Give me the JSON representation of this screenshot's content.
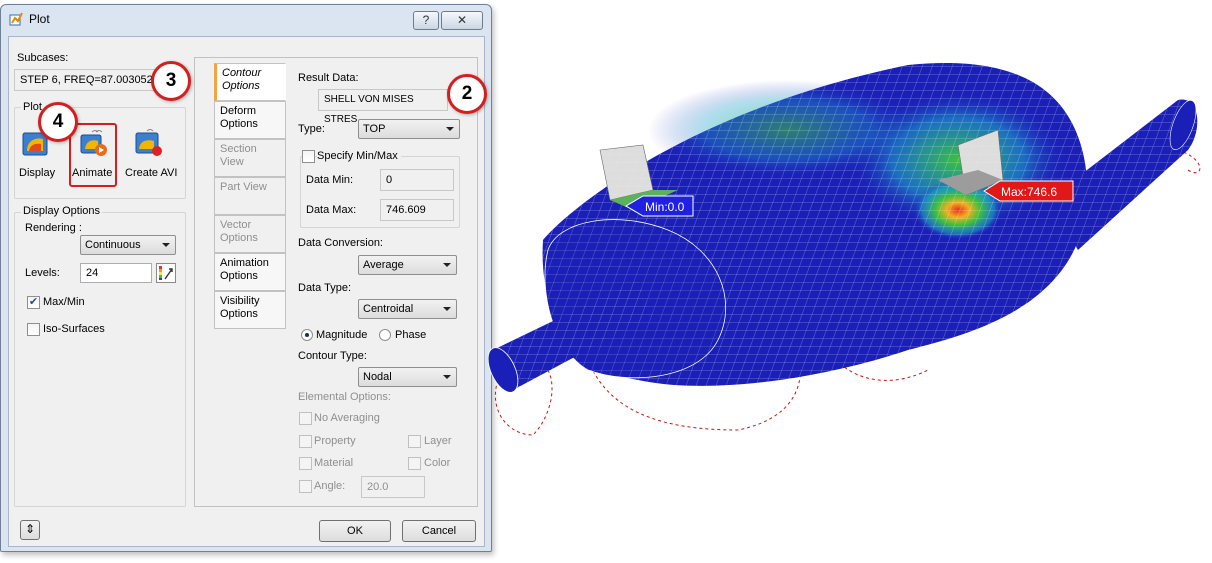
{
  "window": {
    "title": "Plot",
    "help_label": "?",
    "close_label": "✕"
  },
  "subcases": {
    "label": "Subcases:",
    "value": "STEP 6, FREQ=87.003052"
  },
  "plot_group": {
    "label": "Plot",
    "display_label": "Display",
    "animate_label": "Animate",
    "create_avi_label": "Create AVI"
  },
  "display_options": {
    "label": "Display Options",
    "rendering_label": "Rendering :",
    "rendering_value": "Continuous",
    "levels_label": "Levels:",
    "levels_value": "24",
    "maxmin_label": "Max/Min",
    "maxmin_checked": true,
    "iso_label": "Iso-Surfaces",
    "iso_checked": false
  },
  "tabs": [
    {
      "label": "Contour Options",
      "checked": true,
      "active": true,
      "enabled": true
    },
    {
      "label": "Deform Options",
      "checked": true,
      "active": false,
      "enabled": true
    },
    {
      "label": "Section View",
      "checked": false,
      "active": false,
      "enabled": false
    },
    {
      "label": "Part View",
      "checked": false,
      "active": false,
      "enabled": false
    },
    {
      "label": "Vector Options",
      "checked": false,
      "active": false,
      "enabled": false
    },
    {
      "label": "Animation Options",
      "active": false,
      "enabled": true
    },
    {
      "label": "Visibility Options",
      "active": false,
      "enabled": true
    }
  ],
  "contour": {
    "result_data_label": "Result Data:",
    "result_data_value": "SHELL VON MISES STRES",
    "type_label": "Type:",
    "type_value": "TOP",
    "specify_minmax_label": "Specify Min/Max",
    "data_min_label": "Data Min:",
    "data_min_value": "0",
    "data_max_label": "Data Max:",
    "data_max_value": "746.609",
    "data_conversion_label": "Data Conversion:",
    "data_conversion_value": "Average",
    "data_type_label": "Data Type:",
    "data_type_value": "Centroidal",
    "magnitude_label": "Magnitude",
    "phase_label": "Phase",
    "contour_type_label": "Contour Type:",
    "contour_type_value": "Nodal",
    "elemental_options_label": "Elemental Options:",
    "no_averaging_label": "No Averaging",
    "property_label": "Property",
    "layer_label": "Layer",
    "material_label": "Material",
    "color_label": "Color",
    "angle_label": "Angle:",
    "angle_value": "20.0"
  },
  "footer": {
    "expand_label": "⇕",
    "ok_label": "OK",
    "cancel_label": "Cancel"
  },
  "callouts": {
    "c2": "2",
    "c3": "3",
    "c4": "4"
  },
  "model": {
    "min_label": "Min:0.0",
    "max_label": "Max:746.6"
  },
  "colors": {
    "mesh_blue": "#1a1fb8",
    "callout_red": "#d41f1f",
    "max_red": "#e01818",
    "min_blue": "#2020e0"
  }
}
